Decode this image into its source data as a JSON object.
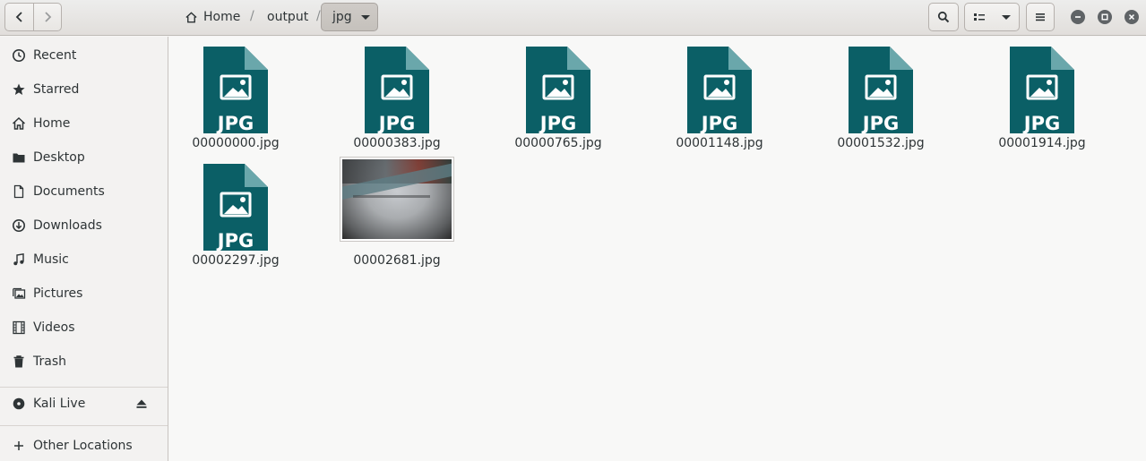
{
  "breadcrumb": {
    "home_label": "Home",
    "sep1": "/",
    "output_label": "output",
    "sep2": "/",
    "current_label": "jpg"
  },
  "sidebar": {
    "items": [
      {
        "label": "Recent",
        "icon": "clock-icon"
      },
      {
        "label": "Starred",
        "icon": "star-icon"
      },
      {
        "label": "Home",
        "icon": "home-icon"
      },
      {
        "label": "Desktop",
        "icon": "folder-icon"
      },
      {
        "label": "Documents",
        "icon": "document-icon"
      },
      {
        "label": "Downloads",
        "icon": "download-icon"
      },
      {
        "label": "Music",
        "icon": "music-icon"
      },
      {
        "label": "Pictures",
        "icon": "pictures-icon"
      },
      {
        "label": "Videos",
        "icon": "film-icon"
      },
      {
        "label": "Trash",
        "icon": "trash-icon"
      }
    ],
    "devices": [
      {
        "label": "Kali Live",
        "icon": "disc-icon"
      }
    ],
    "other": {
      "label": "Other Locations",
      "icon": "plus-icon"
    }
  },
  "files": [
    {
      "name": "00000000.jpg",
      "badge": "JPG"
    },
    {
      "name": "00000383.jpg",
      "badge": "JPG"
    },
    {
      "name": "00000765.jpg",
      "badge": "JPG"
    },
    {
      "name": "00001148.jpg",
      "badge": "JPG"
    },
    {
      "name": "00001532.jpg",
      "badge": "JPG"
    },
    {
      "name": "00001914.jpg",
      "badge": "JPG"
    },
    {
      "name": "00002297.jpg",
      "badge": "JPG"
    },
    {
      "name": "00002681.jpg",
      "badge": ""
    }
  ],
  "colors": {
    "file_icon": "#0b5f66",
    "file_icon_fold": "#6aa7ab",
    "accent": "#2e3436"
  }
}
